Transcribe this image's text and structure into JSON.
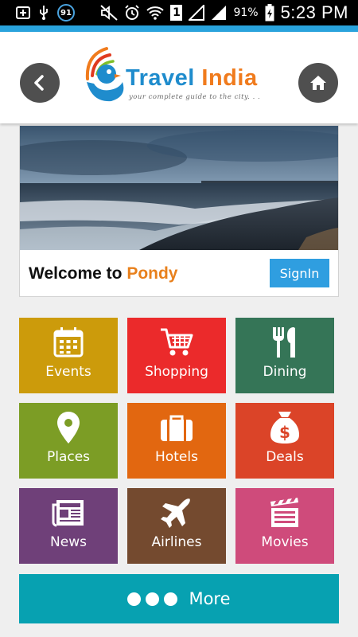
{
  "status_bar": {
    "notification_count": "91",
    "sim_slot": "1",
    "battery_percent": "91%",
    "time": "5:23 PM"
  },
  "header": {
    "logo_word1": "Travel",
    "logo_word2": "India",
    "tagline": "your complete guide to the city. . ."
  },
  "welcome": {
    "prefix": "Welcome to ",
    "city": "Pondy",
    "signin_label": "SignIn"
  },
  "tiles": [
    {
      "label": "Events",
      "color": "#cc9b0b",
      "icon": "calendar-icon"
    },
    {
      "label": "Shopping",
      "color": "#eb2a2b",
      "icon": "shopping-cart-icon"
    },
    {
      "label": "Dining",
      "color": "#357557",
      "icon": "fork-knife-icon"
    },
    {
      "label": "Places",
      "color": "#7c9d25",
      "icon": "map-pin-icon"
    },
    {
      "label": "Hotels",
      "color": "#e26710",
      "icon": "suitcase-icon"
    },
    {
      "label": "Deals",
      "color": "#db4428",
      "icon": "money-bag-icon"
    },
    {
      "label": "News",
      "color": "#6f4079",
      "icon": "newspaper-icon"
    },
    {
      "label": "Airlines",
      "color": "#744a2f",
      "icon": "airplane-icon"
    },
    {
      "label": "Movies",
      "color": "#cf4b7b",
      "icon": "clapperboard-icon"
    }
  ],
  "more": {
    "label": "More"
  },
  "colors": {
    "accent": "#29a3dd",
    "signin": "#2f9ee0",
    "more": "#07a1b1",
    "city": "#e8801c"
  }
}
